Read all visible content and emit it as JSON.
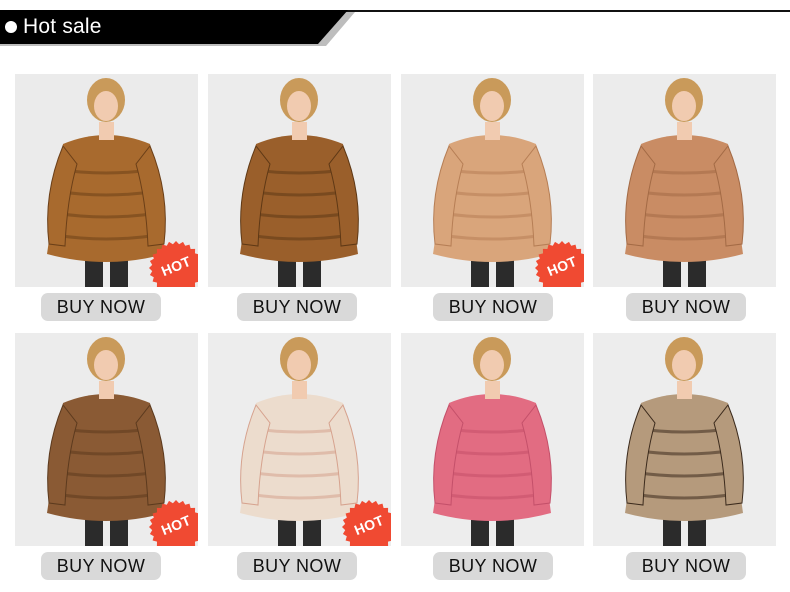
{
  "header": {
    "title": "Hot sale"
  },
  "products": [
    {
      "button_label": "BUY NOW",
      "badge": "HOT",
      "coat_color": "#a86a2e",
      "accent": "#6b3f18",
      "bg": "#ebebeb"
    },
    {
      "button_label": "BUY NOW",
      "badge": "",
      "coat_color": "#9a5f2b",
      "accent": "#5e3815",
      "bg": "#ececec"
    },
    {
      "button_label": "BUY NOW",
      "badge": "HOT",
      "coat_color": "#d9a57b",
      "accent": "#b67e55",
      "bg": "#ececec"
    },
    {
      "button_label": "BUY NOW",
      "badge": "",
      "coat_color": "#c98c64",
      "accent": "#a36a45",
      "bg": "#ececec"
    },
    {
      "button_label": "BUY NOW",
      "badge": "HOT",
      "coat_color": "#8a5a34",
      "accent": "#5c3a1e",
      "bg": "#ececec"
    },
    {
      "button_label": "BUY NOW",
      "badge": "HOT",
      "coat_color": "#ecdccd",
      "accent": "#d6a28e",
      "bg": "#ededed"
    },
    {
      "button_label": "BUY NOW",
      "badge": "",
      "coat_color": "#e26c82",
      "accent": "#c4506a",
      "bg": "#ededed"
    },
    {
      "button_label": "BUY NOW",
      "badge": "",
      "coat_color": "#b59a7c",
      "accent": "#3b2a1c",
      "bg": "#ededed"
    }
  ],
  "colors": {
    "header_bg": "#000000",
    "header_shadow": "#bdbdbd",
    "hot_badge": "#f04a32",
    "button_bg": "#d9d9d9"
  }
}
